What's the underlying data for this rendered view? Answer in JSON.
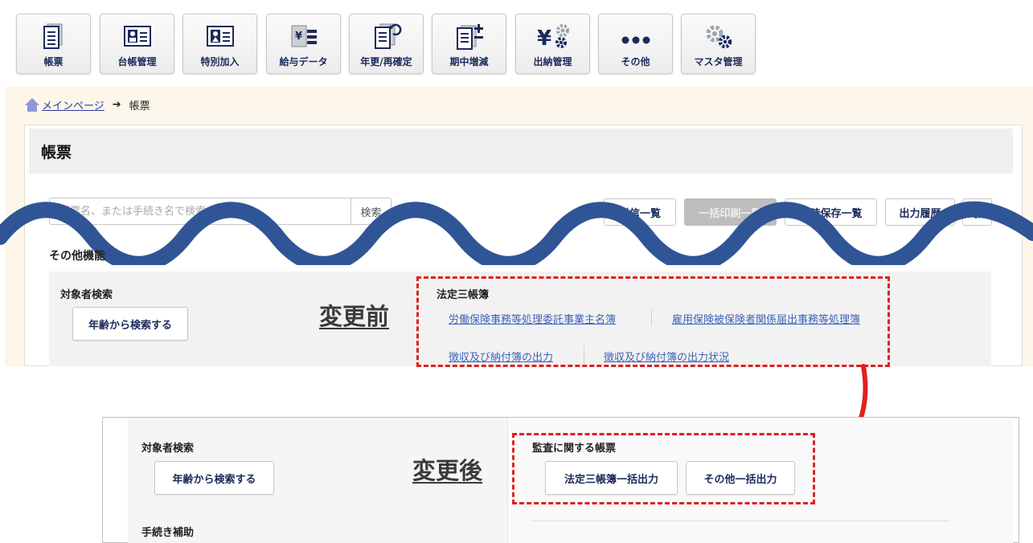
{
  "toolbar": {
    "items": [
      {
        "label": "帳票",
        "icon": "document-icon"
      },
      {
        "label": "台帳管理",
        "icon": "id-card-icon"
      },
      {
        "label": "特別加入",
        "icon": "person-card-icon"
      },
      {
        "label": "給与データ",
        "icon": "salary-icon"
      },
      {
        "label": "年更/再確定",
        "icon": "annual-update-icon"
      },
      {
        "label": "期中増減",
        "icon": "plus-minus-document-icon"
      },
      {
        "label": "出納管理",
        "icon": "yen-gear-icon"
      },
      {
        "label": "その他",
        "icon": "more-dots-icon"
      },
      {
        "label": "マスタ管理",
        "icon": "gears-icon"
      }
    ]
  },
  "breadcrumb": {
    "home": "メインページ",
    "arrow": "➔",
    "current": "帳票"
  },
  "page_title": "帳票",
  "search": {
    "placeholder": "帳票名、または手続き名で検索",
    "button": "検索"
  },
  "right_buttons": {
    "send_list": "送信一覧",
    "bulk_print": "一括印刷一覧",
    "temp_saved": "一時保存一覧",
    "output_history": "出力履歴"
  },
  "before": {
    "section_title": "その他機能",
    "target_search_label": "対象者検索",
    "age_search_button": "年齢から検索する",
    "label": "変更前",
    "group_title": "法定三帳簿",
    "links": [
      "労働保険事務等処理委託事業主名簿",
      "雇用保険被保険者関係届出事務等処理簿",
      "徴収及び納付簿の出力",
      "徴収及び納付簿の出力状況"
    ]
  },
  "after": {
    "target_search_label": "対象者検索",
    "age_search_button": "年齢から検索する",
    "label": "変更後",
    "group_title": "監査に関する帳票",
    "buttons": [
      "法定三帳簿一括出力",
      "その他一括出力"
    ],
    "procedure_help": "手続き補助"
  },
  "colors": {
    "wave": "#2f5597",
    "highlight": "#e0201f",
    "link": "#3e63b8",
    "button_text": "#1c2a5a",
    "upper_bg": "#fdf6ea"
  }
}
